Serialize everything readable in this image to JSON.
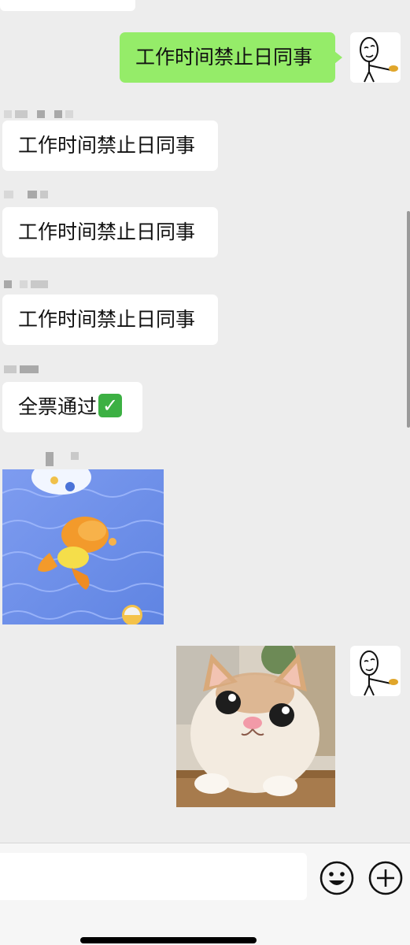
{
  "chat": {
    "messages": [
      {
        "sender": "me",
        "type": "text",
        "text": "工作时间禁止日同事"
      },
      {
        "sender": "other",
        "type": "text",
        "text": "工作时间禁止日同事"
      },
      {
        "sender": "other",
        "type": "text",
        "text": "工作时间禁止日同事"
      },
      {
        "sender": "other",
        "type": "text",
        "text": "工作时间禁止日同事"
      },
      {
        "sender": "other",
        "type": "text",
        "text": "全票通过"
      },
      {
        "sender": "other",
        "type": "image",
        "icon": "pool-duck-image"
      },
      {
        "sender": "me",
        "type": "image",
        "icon": "kitten-image"
      }
    ],
    "approve_emoji": "✓"
  },
  "input_bar": {
    "message_value": "",
    "emoji_icon": "smiley-face-icon",
    "more_icon": "plus-circle-icon"
  },
  "colors": {
    "chat_background": "#ededed",
    "my_bubble": "#95ec69",
    "other_bubble": "#ffffff",
    "approve_check": "#3cb043"
  }
}
